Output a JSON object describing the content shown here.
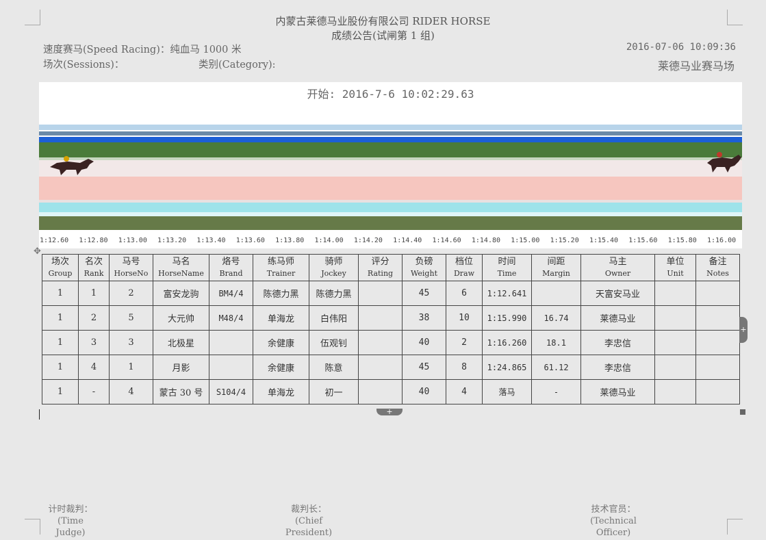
{
  "header": {
    "company": "内蒙古莱德马业股份有限公司 RIDER HORSE",
    "subtitle": "成绩公告(试闸第 1 组)"
  },
  "meta": {
    "race": "速度赛马(Speed Racing)：纯血马 1000 米",
    "sessions": "场次(Sessions)：",
    "category": "类别(Category):",
    "datetime": "2016-07-06   10:09:36",
    "venue": "莱德马业赛马场"
  },
  "photo": {
    "start_label": "开始: 2016-7-6 10:02:29.63",
    "ticks": [
      "1:12.60",
      "1:12.80",
      "1:13.00",
      "1:13.20",
      "1:13.40",
      "1:13.60",
      "1:13.80",
      "1:14.00",
      "1:14.20",
      "1:14.40",
      "1:14.60",
      "1:14.80",
      "1:15.00",
      "1:15.20",
      "1:15.40",
      "1:15.60",
      "1:15.80",
      "1:16.00"
    ]
  },
  "table": {
    "columns": [
      {
        "zh": "场次",
        "en": "Group"
      },
      {
        "zh": "名次",
        "en": "Rank"
      },
      {
        "zh": "马号",
        "en": "HorseNo"
      },
      {
        "zh": "马名",
        "en": "HorseName"
      },
      {
        "zh": "烙号",
        "en": "Brand"
      },
      {
        "zh": "练马师",
        "en": "Trainer"
      },
      {
        "zh": "骑师",
        "en": "Jockey"
      },
      {
        "zh": "评分",
        "en": "Rating"
      },
      {
        "zh": "负磅",
        "en": "Weight"
      },
      {
        "zh": "档位",
        "en": "Draw"
      },
      {
        "zh": "时间",
        "en": "Time"
      },
      {
        "zh": "间距",
        "en": "Margin"
      },
      {
        "zh": "马主",
        "en": "Owner"
      },
      {
        "zh": "单位",
        "en": "Unit"
      },
      {
        "zh": "备注",
        "en": "Notes"
      }
    ],
    "rows": [
      [
        "1",
        "1",
        "2",
        "富安龙驹",
        "BM4/4",
        "陈德力黑",
        "陈德力黑",
        "",
        "45",
        "6",
        "1:12.641",
        "",
        "天富安马业",
        "",
        ""
      ],
      [
        "1",
        "2",
        "5",
        "大元帅",
        "M48/4",
        "单海龙",
        "白伟阳",
        "",
        "38",
        "10",
        "1:15.990",
        "16.74",
        "莱德马业",
        "",
        ""
      ],
      [
        "1",
        "3",
        "3",
        "北极星",
        "",
        "余健康",
        "伍观钊",
        "",
        "40",
        "2",
        "1:16.260",
        "18.1",
        "李忠信",
        "",
        ""
      ],
      [
        "1",
        "4",
        "1",
        "月影",
        "",
        "余健康",
        "陈意",
        "",
        "45",
        "8",
        "1:24.865",
        "61.12",
        "李忠信",
        "",
        ""
      ],
      [
        "1",
        "-",
        "4",
        "蒙古 30 号",
        "S104/4",
        "单海龙",
        "初一",
        "",
        "40",
        "4",
        "落马",
        "-",
        "莱德马业",
        "",
        ""
      ]
    ]
  },
  "footer": {
    "time_judge": "计时裁判：",
    "time_judge_en": "(Time Judge)",
    "chief": "裁判长：",
    "chief_en": "(Chief President)",
    "officer": "技术官员：",
    "officer_en": "(Technical Officer)"
  },
  "icons": {
    "move_handle": "move-icon",
    "add_row": "plus-icon",
    "add_column": "plus-icon"
  }
}
